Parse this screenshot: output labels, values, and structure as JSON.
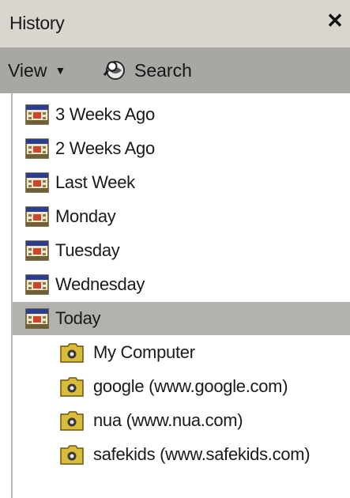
{
  "panel": {
    "title": "History",
    "close_glyph": "✕"
  },
  "toolbar": {
    "view_label": "View",
    "view_arrow": "▼",
    "search_label": "Search"
  },
  "days": [
    {
      "label": "3 Weeks Ago",
      "icon": "calendar-icon",
      "selected": false
    },
    {
      "label": "2 Weeks Ago",
      "icon": "calendar-icon",
      "selected": false
    },
    {
      "label": "Last Week",
      "icon": "calendar-icon",
      "selected": false
    },
    {
      "label": "Monday",
      "icon": "calendar-icon",
      "selected": false
    },
    {
      "label": "Tuesday",
      "icon": "calendar-icon",
      "selected": false
    },
    {
      "label": "Wednesday",
      "icon": "calendar-icon",
      "selected": false
    },
    {
      "label": "Today",
      "icon": "calendar-icon",
      "selected": true
    }
  ],
  "sites": [
    {
      "label": "My Computer",
      "icon": "folder-icon"
    },
    {
      "label": "google (www.google.com)",
      "icon": "folder-icon"
    },
    {
      "label": "nua (www.nua.com)",
      "icon": "folder-icon"
    },
    {
      "label": "safekids (www.safekids.com)",
      "icon": "folder-icon"
    }
  ],
  "colors": {
    "titlebar": "#d9d5cf",
    "toolbar": "#a9a7a4",
    "selected_row": "#b3b1ae",
    "calendar_header": "#2a3d8f",
    "folder_yellow": "#d8bc3a"
  }
}
